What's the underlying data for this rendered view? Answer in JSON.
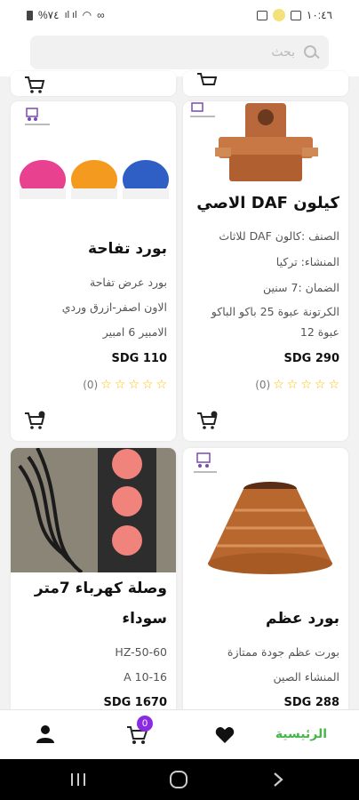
{
  "status_bar": {
    "left_text": "%٧٤",
    "time": "١٠:٤٦"
  },
  "search": {
    "placeholder": "بحث"
  },
  "products": [
    {
      "title": "بورد تفاحة",
      "lines": [
        "بورد عرض تفاحة",
        "الاون  اصفر-ازرق وردي",
        "الامبير 6 امبير"
      ],
      "price": "SDG 110",
      "rating_count": "(0)"
    },
    {
      "title": "كيلون DAF الاصي",
      "lines": [
        "الصنف :كالون DAF للاثاث",
        "المنشاء: تركيا",
        "الضمان :7 سنين",
        "الكرتونة عبوة 25 باكو الباكو",
        "عبوة 12"
      ],
      "price": "SDG 290",
      "rating_count": "(0)"
    },
    {
      "title": "وصلة كهرباء 7متر",
      "title_line2": "سوداء",
      "lines": [
        "HZ-50-60",
        "A 10-16"
      ],
      "price": "SDG 1670"
    },
    {
      "title": "بورد عظم",
      "lines": [
        "بورت عظم جودة ممتازة",
        "المنشاء الصين"
      ],
      "price": "SDG 288"
    }
  ],
  "bottom_nav": {
    "home_label": "الرئيسية",
    "cart_count": "0"
  },
  "colors": {
    "accent_green": "#47b649",
    "badge_purple": "#8a2be2",
    "star_yellow": "#f2c300"
  }
}
